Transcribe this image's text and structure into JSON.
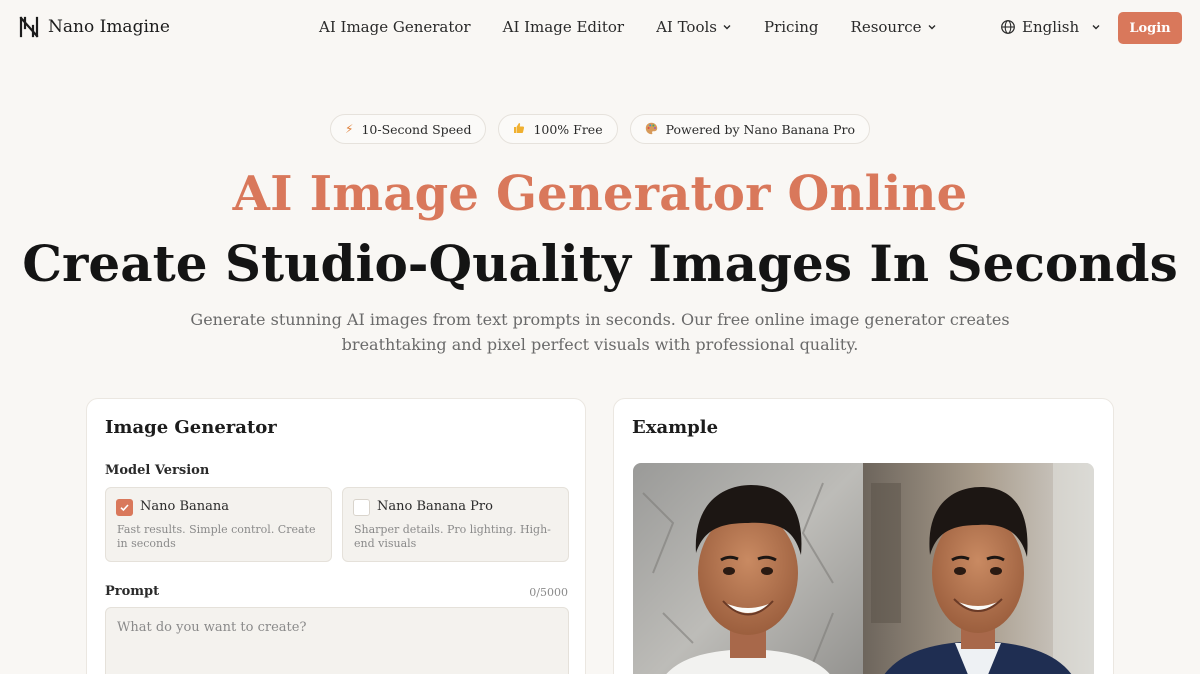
{
  "nav": {
    "brand": "Nano Imagine",
    "links": [
      {
        "label": "AI Image Generator",
        "dropdown": false
      },
      {
        "label": "AI Image Editor",
        "dropdown": false
      },
      {
        "label": "AI Tools",
        "dropdown": true
      },
      {
        "label": "Pricing",
        "dropdown": false
      },
      {
        "label": "Resource",
        "dropdown": true
      }
    ],
    "language": "English",
    "login": "Login"
  },
  "badges": [
    {
      "icon": "lightning-icon",
      "label": "10-Second Speed"
    },
    {
      "icon": "thumbs-up-icon",
      "label": "100% Free"
    },
    {
      "icon": "palette-icon",
      "label": "Powered by Nano Banana Pro"
    }
  ],
  "hero": {
    "title": "AI Image Generator Online",
    "subtitle": "Create Studio-Quality Images In Seconds",
    "description": "Generate stunning AI images from text prompts in seconds. Our free online image generator creates breathtaking and pixel perfect visuals with professional quality."
  },
  "generator": {
    "title": "Image Generator",
    "model_label": "Model Version",
    "models": [
      {
        "name": "Nano Banana",
        "desc": "Fast results. Simple control. Create in seconds",
        "selected": true
      },
      {
        "name": "Nano Banana Pro",
        "desc": "Sharper details. Pro lighting. High-end visuals",
        "selected": false
      }
    ],
    "prompt_label": "Prompt",
    "prompt_counter": "0/5000",
    "prompt_placeholder": "What do you want to create?"
  },
  "example": {
    "title": "Example"
  },
  "colors": {
    "accent": "#d9785b",
    "background": "#f9f7f4",
    "card": "#ffffff"
  }
}
